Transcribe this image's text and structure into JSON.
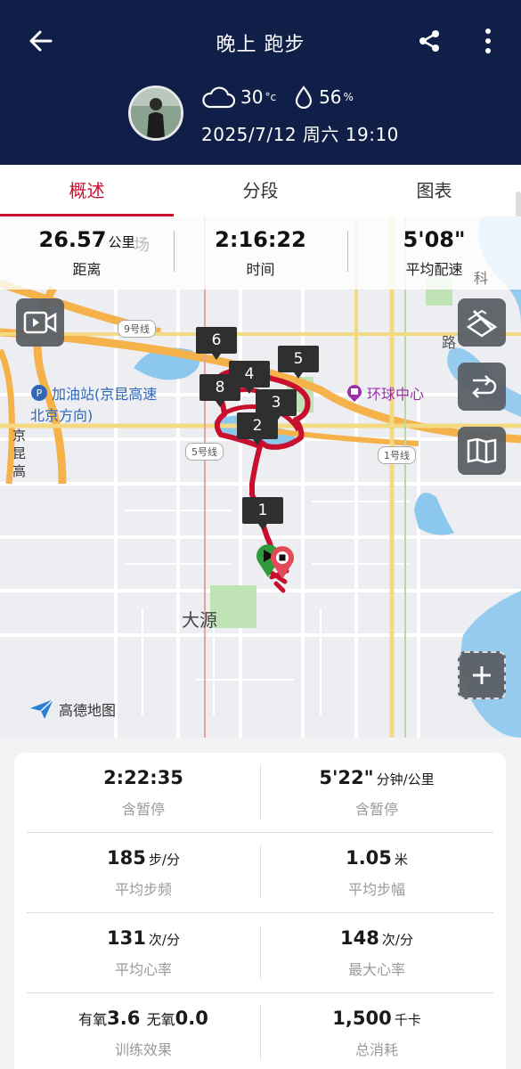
{
  "header": {
    "title": "晚上 跑步",
    "temperature": "30",
    "temp_unit": "°c",
    "humidity": "56",
    "humidity_unit": "%",
    "datetime": "2025/7/12 周六 19:10"
  },
  "tabs": [
    {
      "label": "概述",
      "active": true
    },
    {
      "label": "分段",
      "active": false
    },
    {
      "label": "图表",
      "active": false
    }
  ],
  "summary": {
    "distance": "26.57",
    "distance_unit": "公里",
    "distance_label": "距离",
    "time": "2:16:22",
    "time_label": "时间",
    "pace": "5'08\"",
    "pace_label": "平均配速"
  },
  "map": {
    "labels": {
      "place_dayuan": "大源",
      "gas_station_line1": "加油站(京昆高速",
      "gas_station_line2": "北京方向)",
      "mall": "环球中心",
      "road_jingkun": "京昆高",
      "line9": "9号线",
      "line5": "5号线",
      "line1": "1号线",
      "bg_chang": "场",
      "bg_ke": "科",
      "bg_lu": "路",
      "provider": "高德地图"
    },
    "flags": [
      "1",
      "2",
      "3",
      "4",
      "5",
      "6",
      "8"
    ]
  },
  "details": [
    {
      "value": "2:22:35",
      "unit": "",
      "label": "含暂停"
    },
    {
      "value": "5'22\"",
      "unit": "分钟/公里",
      "label": "含暂停"
    },
    {
      "value": "185",
      "unit": "步/分",
      "label": "平均步频"
    },
    {
      "value": "1.05",
      "unit": "米",
      "label": "平均步幅"
    },
    {
      "value": "131",
      "unit": "次/分",
      "label": "平均心率"
    },
    {
      "value": "148",
      "unit": "次/分",
      "label": "最大心率"
    },
    {
      "aerobic_prefix": "有氧",
      "aerobic_value": "3.6",
      "anaerobic_prefix": "无氧",
      "anaerobic_value": "0.0",
      "label": "训练效果"
    },
    {
      "value": "1,500",
      "unit": "千卡",
      "label": "总消耗"
    }
  ],
  "colors": {
    "header_bg": "#0f1f47",
    "accent_red": "#c8102e",
    "route": "#c8102e"
  }
}
